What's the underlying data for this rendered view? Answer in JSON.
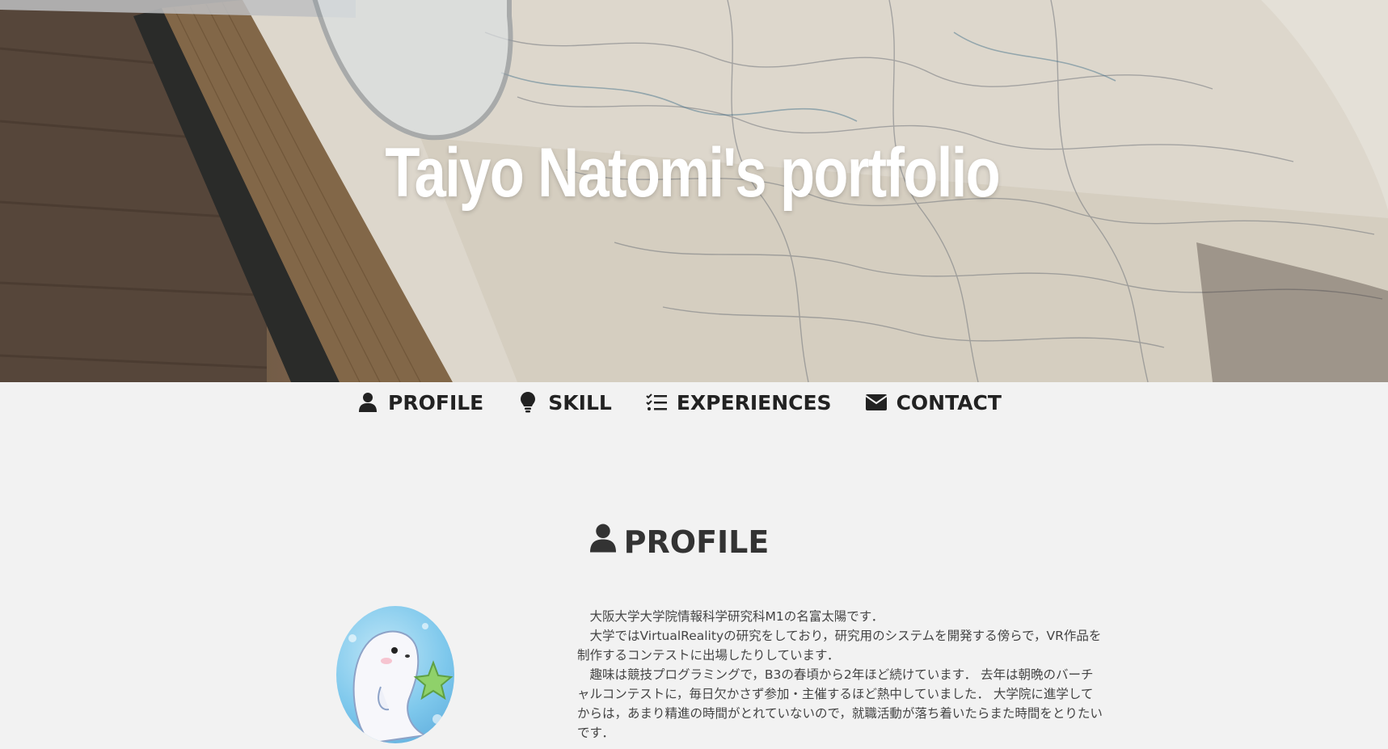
{
  "header": {
    "title": "Taiyo Natomi's portfolio"
  },
  "nav": {
    "items": [
      {
        "label": "PROFILE",
        "icon": "user-icon"
      },
      {
        "label": "SKILL",
        "icon": "lightbulb-icon"
      },
      {
        "label": "EXPERIENCES",
        "icon": "tasks-icon"
      },
      {
        "label": "CONTACT",
        "icon": "envelope-icon"
      }
    ]
  },
  "profile": {
    "title": "PROFILE",
    "avatar_icon": "seal-avatar-icon",
    "paragraphs": [
      "大阪大学大学院情報科学研究科M1の名富太陽です．",
      "大学ではVirtualRealityの研究をしており，研究用のシステムを開発する傍らで，VR作品を制作するコンテストに出場したりしています．",
      "趣味は競技プログラミングで，B3の春頃から2年ほど続けています． 去年は朝晩のバーチャルコンテストに，毎日欠かさず参加・主催するほど熱中していました． 大学院に進学してからは，あまり精進の時間がとれていないので，就職活動が落ち着いたらまた時間をとりたいです．"
    ]
  },
  "colors": {
    "background": "#f2f2f2",
    "text": "#333333",
    "hero_title": "#ffffff"
  }
}
